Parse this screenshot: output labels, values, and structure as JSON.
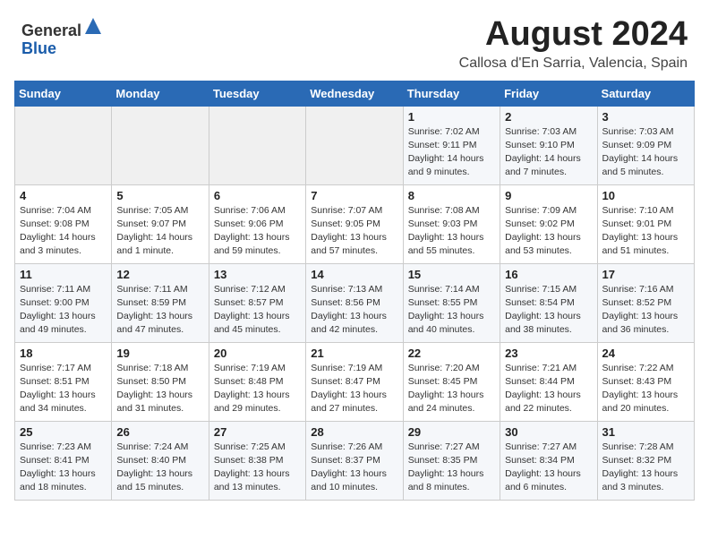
{
  "header": {
    "logo_general": "General",
    "logo_blue": "Blue",
    "month_year": "August 2024",
    "location": "Callosa d'En Sarria, Valencia, Spain"
  },
  "weekdays": [
    "Sunday",
    "Monday",
    "Tuesday",
    "Wednesday",
    "Thursday",
    "Friday",
    "Saturday"
  ],
  "weeks": [
    [
      {
        "day": "",
        "info": ""
      },
      {
        "day": "",
        "info": ""
      },
      {
        "day": "",
        "info": ""
      },
      {
        "day": "",
        "info": ""
      },
      {
        "day": "1",
        "info": "Sunrise: 7:02 AM\nSunset: 9:11 PM\nDaylight: 14 hours\nand 9 minutes."
      },
      {
        "day": "2",
        "info": "Sunrise: 7:03 AM\nSunset: 9:10 PM\nDaylight: 14 hours\nand 7 minutes."
      },
      {
        "day": "3",
        "info": "Sunrise: 7:03 AM\nSunset: 9:09 PM\nDaylight: 14 hours\nand 5 minutes."
      }
    ],
    [
      {
        "day": "4",
        "info": "Sunrise: 7:04 AM\nSunset: 9:08 PM\nDaylight: 14 hours\nand 3 minutes."
      },
      {
        "day": "5",
        "info": "Sunrise: 7:05 AM\nSunset: 9:07 PM\nDaylight: 14 hours\nand 1 minute."
      },
      {
        "day": "6",
        "info": "Sunrise: 7:06 AM\nSunset: 9:06 PM\nDaylight: 13 hours\nand 59 minutes."
      },
      {
        "day": "7",
        "info": "Sunrise: 7:07 AM\nSunset: 9:05 PM\nDaylight: 13 hours\nand 57 minutes."
      },
      {
        "day": "8",
        "info": "Sunrise: 7:08 AM\nSunset: 9:03 PM\nDaylight: 13 hours\nand 55 minutes."
      },
      {
        "day": "9",
        "info": "Sunrise: 7:09 AM\nSunset: 9:02 PM\nDaylight: 13 hours\nand 53 minutes."
      },
      {
        "day": "10",
        "info": "Sunrise: 7:10 AM\nSunset: 9:01 PM\nDaylight: 13 hours\nand 51 minutes."
      }
    ],
    [
      {
        "day": "11",
        "info": "Sunrise: 7:11 AM\nSunset: 9:00 PM\nDaylight: 13 hours\nand 49 minutes."
      },
      {
        "day": "12",
        "info": "Sunrise: 7:11 AM\nSunset: 8:59 PM\nDaylight: 13 hours\nand 47 minutes."
      },
      {
        "day": "13",
        "info": "Sunrise: 7:12 AM\nSunset: 8:57 PM\nDaylight: 13 hours\nand 45 minutes."
      },
      {
        "day": "14",
        "info": "Sunrise: 7:13 AM\nSunset: 8:56 PM\nDaylight: 13 hours\nand 42 minutes."
      },
      {
        "day": "15",
        "info": "Sunrise: 7:14 AM\nSunset: 8:55 PM\nDaylight: 13 hours\nand 40 minutes."
      },
      {
        "day": "16",
        "info": "Sunrise: 7:15 AM\nSunset: 8:54 PM\nDaylight: 13 hours\nand 38 minutes."
      },
      {
        "day": "17",
        "info": "Sunrise: 7:16 AM\nSunset: 8:52 PM\nDaylight: 13 hours\nand 36 minutes."
      }
    ],
    [
      {
        "day": "18",
        "info": "Sunrise: 7:17 AM\nSunset: 8:51 PM\nDaylight: 13 hours\nand 34 minutes."
      },
      {
        "day": "19",
        "info": "Sunrise: 7:18 AM\nSunset: 8:50 PM\nDaylight: 13 hours\nand 31 minutes."
      },
      {
        "day": "20",
        "info": "Sunrise: 7:19 AM\nSunset: 8:48 PM\nDaylight: 13 hours\nand 29 minutes."
      },
      {
        "day": "21",
        "info": "Sunrise: 7:19 AM\nSunset: 8:47 PM\nDaylight: 13 hours\nand 27 minutes."
      },
      {
        "day": "22",
        "info": "Sunrise: 7:20 AM\nSunset: 8:45 PM\nDaylight: 13 hours\nand 24 minutes."
      },
      {
        "day": "23",
        "info": "Sunrise: 7:21 AM\nSunset: 8:44 PM\nDaylight: 13 hours\nand 22 minutes."
      },
      {
        "day": "24",
        "info": "Sunrise: 7:22 AM\nSunset: 8:43 PM\nDaylight: 13 hours\nand 20 minutes."
      }
    ],
    [
      {
        "day": "25",
        "info": "Sunrise: 7:23 AM\nSunset: 8:41 PM\nDaylight: 13 hours\nand 18 minutes."
      },
      {
        "day": "26",
        "info": "Sunrise: 7:24 AM\nSunset: 8:40 PM\nDaylight: 13 hours\nand 15 minutes."
      },
      {
        "day": "27",
        "info": "Sunrise: 7:25 AM\nSunset: 8:38 PM\nDaylight: 13 hours\nand 13 minutes."
      },
      {
        "day": "28",
        "info": "Sunrise: 7:26 AM\nSunset: 8:37 PM\nDaylight: 13 hours\nand 10 minutes."
      },
      {
        "day": "29",
        "info": "Sunrise: 7:27 AM\nSunset: 8:35 PM\nDaylight: 13 hours\nand 8 minutes."
      },
      {
        "day": "30",
        "info": "Sunrise: 7:27 AM\nSunset: 8:34 PM\nDaylight: 13 hours\nand 6 minutes."
      },
      {
        "day": "31",
        "info": "Sunrise: 7:28 AM\nSunset: 8:32 PM\nDaylight: 13 hours\nand 3 minutes."
      }
    ]
  ]
}
